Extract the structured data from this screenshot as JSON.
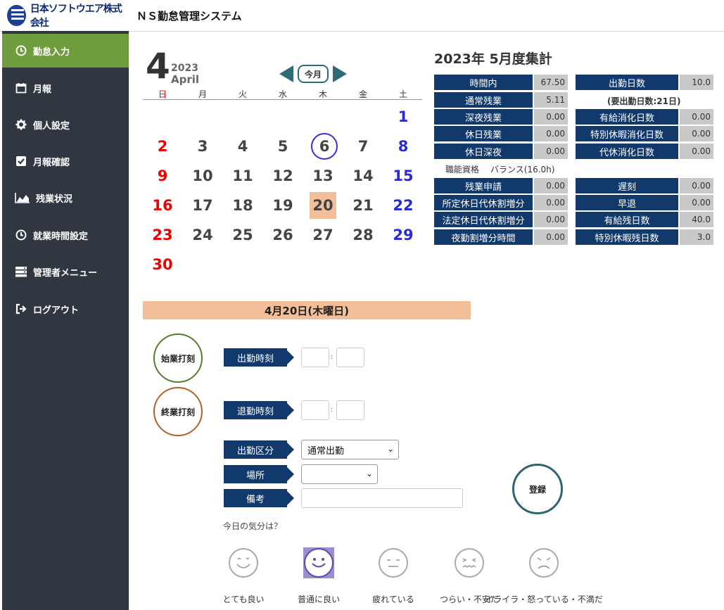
{
  "header": {
    "logo_text": "日本ソフトウエア株式会社",
    "app_title": "ＮＳ勤怠管理システム"
  },
  "sidebar": {
    "items": [
      {
        "label": "勤怠入力",
        "icon": "clock-icon"
      },
      {
        "label": "月報",
        "icon": "calendar-icon"
      },
      {
        "label": "個人設定",
        "icon": "gear-icon"
      },
      {
        "label": "月報確認",
        "icon": "checkbox-icon"
      },
      {
        "label": "残業状況",
        "icon": "area-chart-icon"
      },
      {
        "label": "就業時間設定",
        "icon": "clock-icon"
      },
      {
        "label": "管理者メニュー",
        "icon": "server-icon"
      },
      {
        "label": "ログアウト",
        "icon": "logout-icon"
      }
    ]
  },
  "calendar": {
    "month": "4",
    "year": "2023",
    "month_name": "April",
    "today_label": "今月",
    "weekdays": [
      "日",
      "月",
      "火",
      "水",
      "木",
      "金",
      "土"
    ],
    "days": [
      "1",
      "2",
      "3",
      "4",
      "5",
      "6",
      "7",
      "8",
      "9",
      "10",
      "11",
      "12",
      "13",
      "14",
      "15",
      "16",
      "17",
      "18",
      "19",
      "20",
      "21",
      "22",
      "23",
      "24",
      "25",
      "26",
      "27",
      "28",
      "29",
      "30"
    ],
    "first_weekday_index": 6,
    "today_day": 6,
    "selected_day": 20
  },
  "summary": {
    "title": "2023年 5月度集計",
    "left_top": [
      {
        "label": "時間内",
        "value": "67.50"
      },
      {
        "label": "通常残業",
        "value": "5.11"
      },
      {
        "label": "深夜残業",
        "value": "0.00"
      },
      {
        "label": "休日残業",
        "value": "0.00"
      },
      {
        "label": "休日深夜",
        "value": "0.00"
      }
    ],
    "right_top": [
      {
        "label": "出勤日数",
        "value": "10.0"
      },
      {
        "label": "有給消化日数",
        "value": "0.00"
      },
      {
        "label": "特別休暇消化日数",
        "value": "0.00"
      },
      {
        "label": "代休消化日数",
        "value": "0.00"
      }
    ],
    "required_days": "(要出勤日数:21日)",
    "skill_label": "職能資格",
    "balance_label": "バランス(16.0h)",
    "left_bottom": [
      {
        "label": "残業申請",
        "value": "0.00"
      },
      {
        "label": "所定休日代休割増分",
        "value": "0.00"
      },
      {
        "label": "法定休日代休割増分",
        "value": "0.00"
      },
      {
        "label": "夜勤割増分時間",
        "value": "0.00"
      }
    ],
    "right_bottom": [
      {
        "label": "遅刻",
        "value": "0.00"
      },
      {
        "label": "早退",
        "value": "0.00"
      },
      {
        "label": "有給残日数",
        "value": "40.0"
      },
      {
        "label": "特別休暇残日数",
        "value": "3.0"
      }
    ]
  },
  "entry": {
    "date_title": "4月20日(木曜日)",
    "start_stamp": "始業打刻",
    "end_stamp": "終業打刻",
    "start_time_label": "出勤時刻",
    "end_time_label": "退勤時刻",
    "time_separator": ":",
    "category_label": "出勤区分",
    "category_value": "通常出勤",
    "place_label": "場所",
    "place_value": "",
    "note_label": "備考",
    "note_value": "",
    "register_label": "登録",
    "mood_question": "今日の気分は？",
    "moods": [
      "とても良い",
      "普通に良い",
      "疲れている",
      "つらい・不安だ",
      "イライラ・怒っている・不満だ"
    ],
    "selected_mood_index": 1
  },
  "colors": {
    "sidebar_bg": "#313740",
    "active_nav": "#6f9c3c",
    "label_bg": "#12396b",
    "value_bg": "#c9c9c9",
    "selected_day_bg": "#f2bf98",
    "mood_selected_bg": "#9b8fd4"
  }
}
